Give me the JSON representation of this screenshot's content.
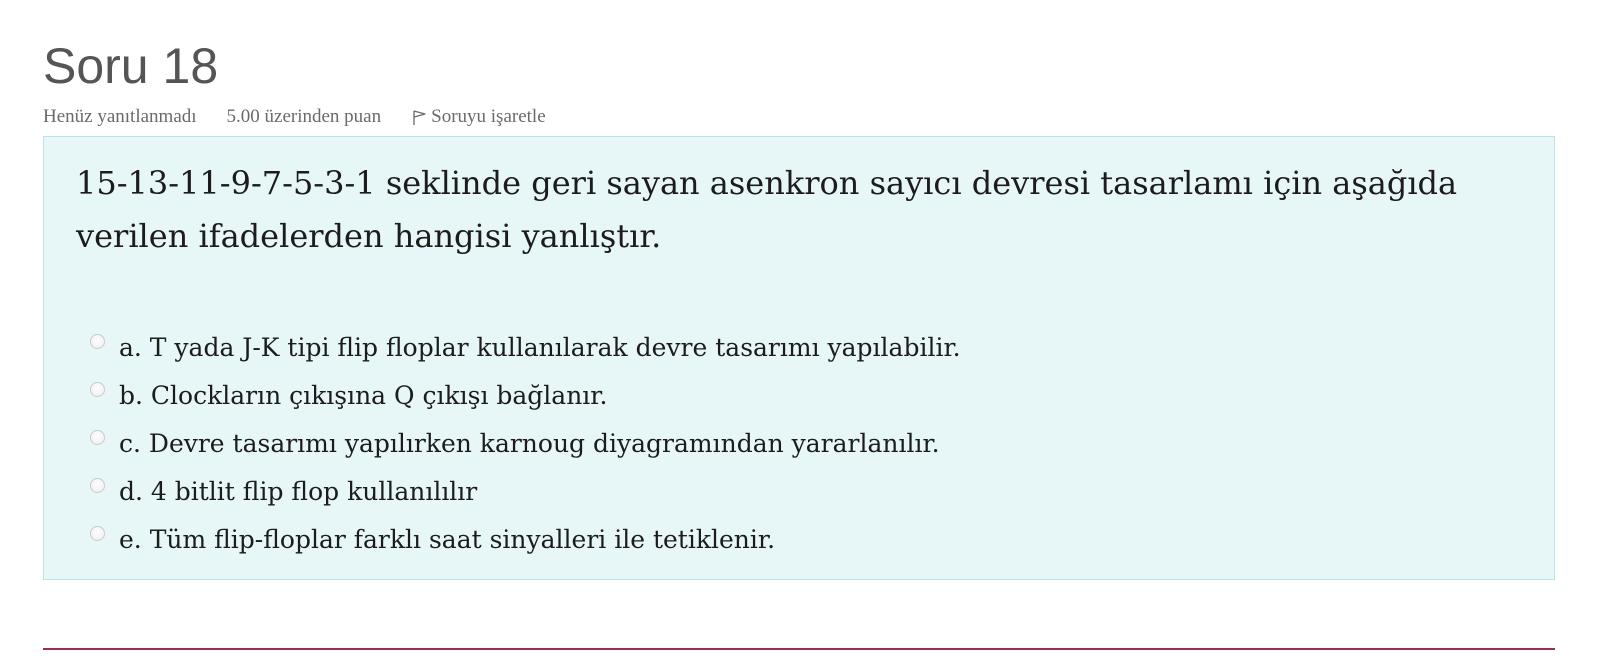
{
  "question": {
    "title": "Soru 18",
    "status": "Henüz yanıtlanmadı",
    "grade": "5.00 üzerinden puan",
    "flag_label": "Soruyu işaretle",
    "flag_icon": "flag-icon",
    "text": "15-13-11-9-7-5-3-1 seklinde geri sayan asenkron sayıcı devresi tasarlamı için aşağıda verilen ifadelerden hangisi yanlıştır.",
    "answers": [
      {
        "label": "a. T yada J-K tipi flip floplar kullanılarak devre tasarımı yapılabilir.",
        "selected": false
      },
      {
        "label": "b. Clockların çıkışına Q çıkışı bağlanır.",
        "selected": false
      },
      {
        "label": "c. Devre tasarımı yapılırken karnoug diyagramından yararlanılır.",
        "selected": false
      },
      {
        "label": "d. 4 bitlit flip flop kullanılılır",
        "selected": false
      },
      {
        "label": "e. Tüm flip-floplar farklı saat sinyalleri ile tetiklenir.",
        "selected": false
      }
    ]
  },
  "colors": {
    "formulation_bg": "#e7f6f7",
    "formulation_border": "#b8e4e8",
    "divider": "#9b2c4a",
    "title": "#555555"
  }
}
